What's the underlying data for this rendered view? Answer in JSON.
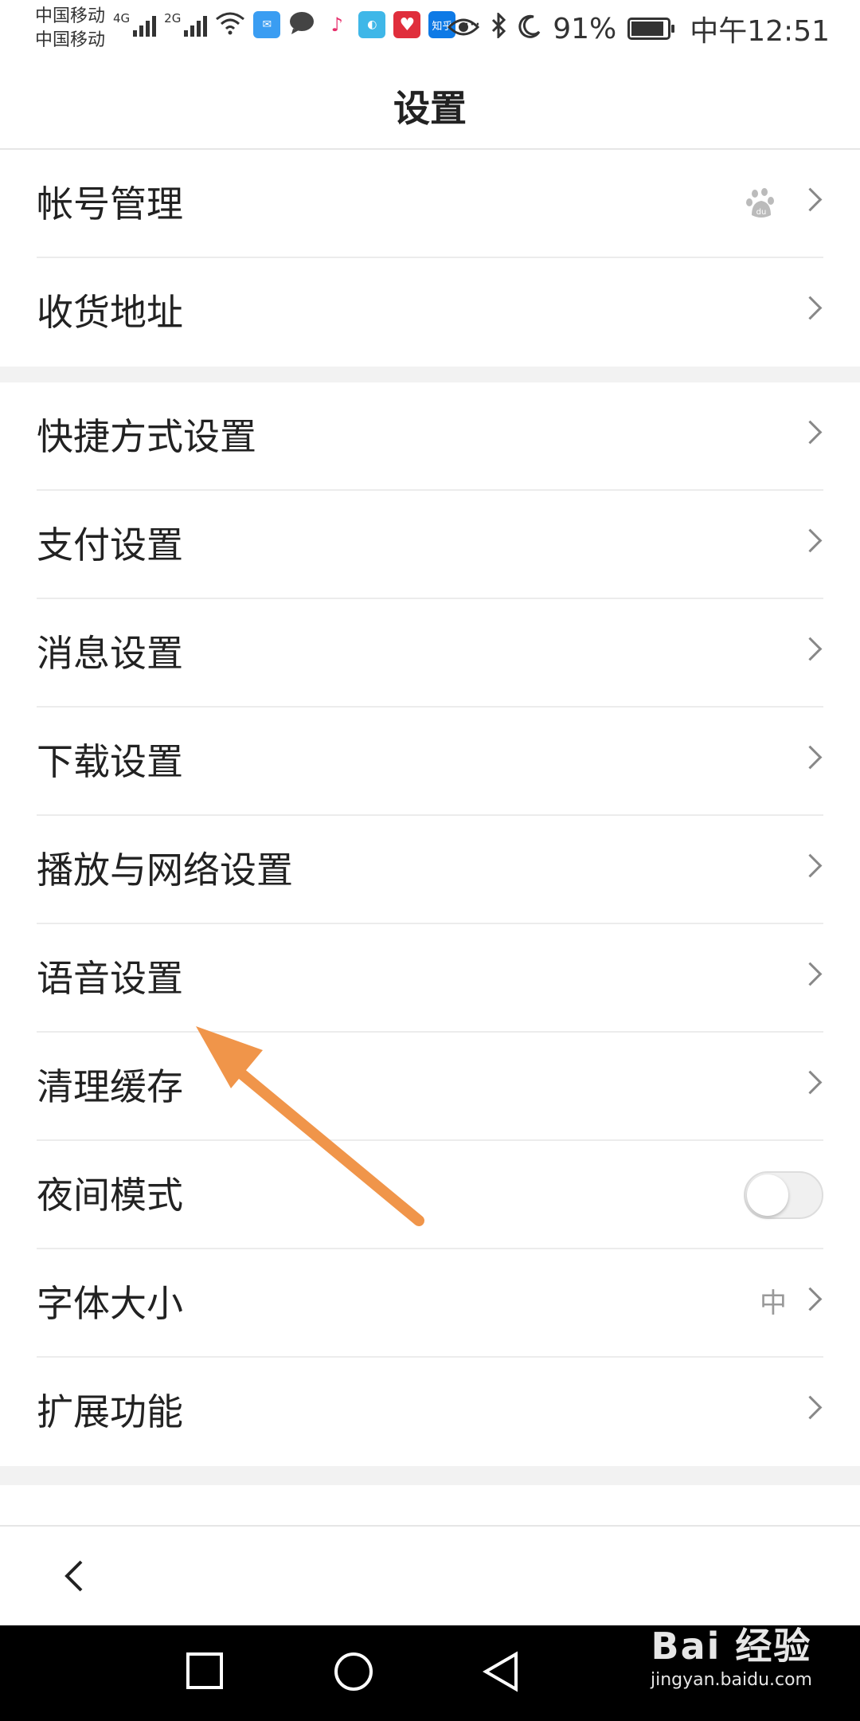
{
  "status_bar": {
    "carrier1": "中国移动",
    "carrier2": "中国移动",
    "network1": "4G",
    "network2": "2G",
    "zhihu": "知乎",
    "more": "···",
    "battery_percent": "91%",
    "battery_level": 0.91,
    "time": "中午12:51"
  },
  "header": {
    "title": "设置"
  },
  "groups": [
    {
      "items": [
        {
          "label": "帐号管理",
          "icon": "baidu-paw-icon"
        },
        {
          "label": "收货地址"
        }
      ]
    },
    {
      "items": [
        {
          "label": "快捷方式设置"
        },
        {
          "label": "支付设置"
        },
        {
          "label": "消息设置"
        },
        {
          "label": "下载设置"
        },
        {
          "label": "播放与网络设置"
        },
        {
          "label": "语音设置"
        },
        {
          "label": "清理缓存"
        },
        {
          "label": "夜间模式",
          "toggle": false
        },
        {
          "label": "字体大小",
          "value": "中"
        },
        {
          "label": "扩展功能"
        }
      ]
    }
  ],
  "watermark": {
    "main": "Bai 经验",
    "sub": "jingyan.baidu.com"
  },
  "colors": {
    "arrow": "#f0954a",
    "background_gap": "#f2f2f2"
  }
}
